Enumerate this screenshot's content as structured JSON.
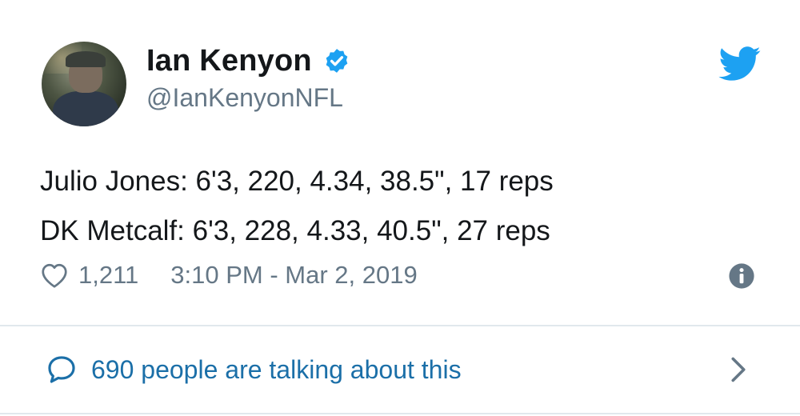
{
  "author": {
    "name": "Ian Kenyon",
    "handle": "@IanKenyonNFL",
    "verified": true
  },
  "tweet": {
    "lines": [
      "Julio Jones: 6'3, 220, 4.34, 38.5\", 17 reps",
      "DK Metcalf: 6'3, 228, 4.33, 40.5\", 27 reps"
    ]
  },
  "meta": {
    "likes": "1,211",
    "timestamp": "3:10 PM - Mar 2, 2019"
  },
  "footer": {
    "talking_text": "690 people are talking about this"
  },
  "colors": {
    "twitter_blue": "#1da1f2",
    "link_blue": "#1b6fa8",
    "secondary_text": "#657786",
    "primary_text": "#14171a"
  },
  "icons": {
    "verified": "verified-badge-icon",
    "brand": "twitter-bird-icon",
    "like": "heart-icon",
    "info": "info-icon",
    "reply": "speech-bubble-icon",
    "more": "chevron-right-icon"
  }
}
